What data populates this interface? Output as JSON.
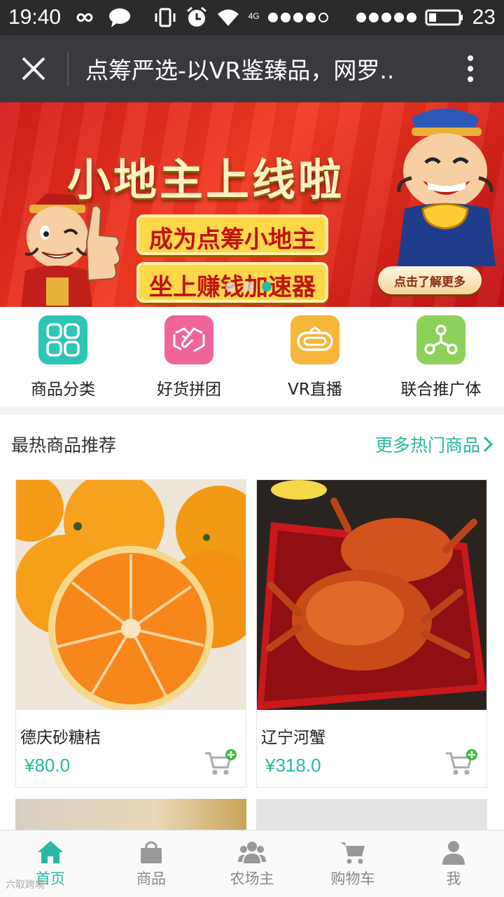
{
  "status_bar": {
    "time": "19:40",
    "network": "4G",
    "battery": "23"
  },
  "titlebar": {
    "title": "点筹严选-以VR鉴臻品，网罗.."
  },
  "banner": {
    "headline": "小地主上线啦",
    "line1": "成为点筹小地主",
    "line2": "坐上赚钱加速器",
    "cta": "点击了解更多",
    "slide_count": 3,
    "active_slide": 3
  },
  "quicknav": [
    {
      "label": "商品分类",
      "color": "#2ec5b4",
      "icon": "grid-icon"
    },
    {
      "label": "好货拼团",
      "color": "#f0649a",
      "icon": "handshake-icon"
    },
    {
      "label": "VR直播",
      "color": "#f6b63a",
      "icon": "vr-headset-icon"
    },
    {
      "label": "联合推广体",
      "color": "#8ed15a",
      "icon": "share-network-icon"
    }
  ],
  "hot": {
    "title": "最热商品推荐",
    "more": "更多热门商品",
    "products": [
      {
        "name": "德庆砂糖桔",
        "price": "¥80.0"
      },
      {
        "name": "辽宁河蟹",
        "price": "¥318.0"
      }
    ]
  },
  "tabbar": [
    {
      "label": "首页",
      "icon": "home-icon",
      "active": true
    },
    {
      "label": "商品",
      "icon": "shopping-bag-icon",
      "active": false
    },
    {
      "label": "农场主",
      "icon": "group-icon",
      "active": false
    },
    {
      "label": "购物车",
      "icon": "cart-icon",
      "active": false
    },
    {
      "label": "我",
      "icon": "user-icon",
      "active": false
    }
  ],
  "watermark": "六取跨境",
  "colors": {
    "accent": "#29b8a0",
    "titlebar": "#393a3f"
  }
}
